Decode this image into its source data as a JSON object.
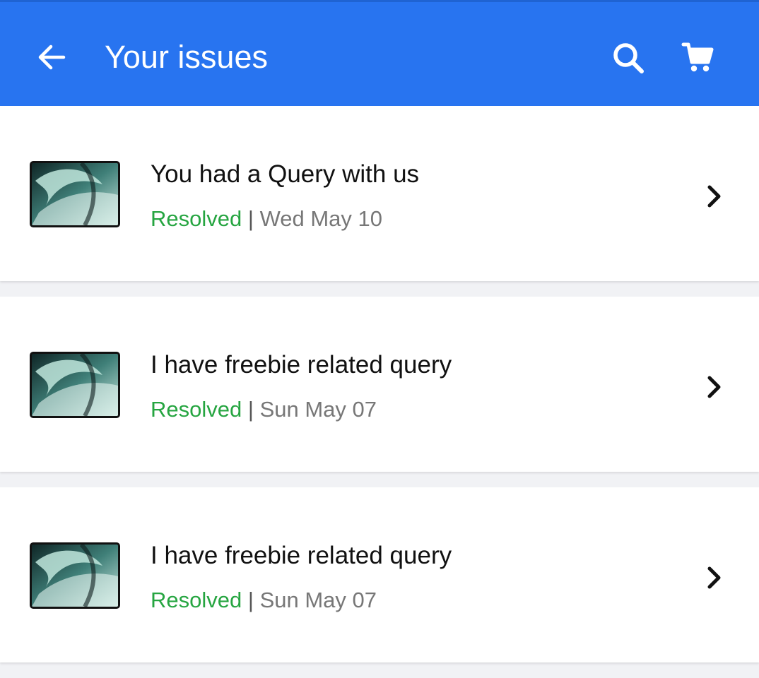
{
  "header": {
    "title": "Your issues",
    "back_icon": "arrow-left-icon",
    "search_icon": "search-icon",
    "cart_icon": "cart-icon",
    "background_color": "#2874f0"
  },
  "issues": [
    {
      "title": "You had a Query with us",
      "status": "Resolved",
      "separator": "|",
      "date": "Wed May 10"
    },
    {
      "title": "I have freebie related query",
      "status": "Resolved",
      "separator": "|",
      "date": "Sun May 07"
    },
    {
      "title": "I have freebie related query",
      "status": "Resolved",
      "separator": "|",
      "date": "Sun May 07"
    }
  ],
  "colors": {
    "status_resolved": "#26a541",
    "date_text": "#777777"
  }
}
